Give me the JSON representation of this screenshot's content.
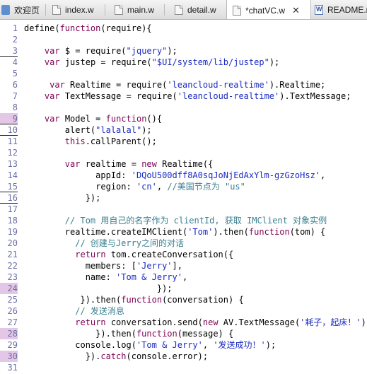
{
  "tabs": [
    {
      "label": "欢迎页",
      "icon": "welcome-page-icon",
      "active": false
    },
    {
      "label": "index.w",
      "icon": "w-file-icon",
      "active": false
    },
    {
      "label": "main.w",
      "icon": "w-file-icon",
      "active": false
    },
    {
      "label": "detail.w",
      "icon": "w-file-icon",
      "active": false
    },
    {
      "label": "*chatVC.w",
      "icon": "w-file-icon",
      "active": true
    },
    {
      "label": "README.m",
      "icon": "document-icon",
      "active": false
    }
  ],
  "close_glyph": "✕",
  "colors": {
    "keyword": "#7f0055",
    "string": "#1a2bc2",
    "comment": "#3b7f8f",
    "line_number": "#6b6fa7",
    "marker": "#e4c7e7"
  },
  "line_numbers": [
    "1",
    "2",
    "3",
    "4",
    "5",
    "6",
    "7",
    "8",
    "9",
    "10",
    "11",
    "12",
    "13",
    "14",
    "15",
    "16",
    "17",
    "18",
    "19",
    "20",
    "21",
    "22",
    "23",
    "24",
    "25",
    "26",
    "27",
    "28",
    "29",
    "30",
    "31"
  ],
  "highlighted_lines": [
    9,
    24,
    28,
    30
  ],
  "lines": [
    [
      [
        "t",
        "define("
      ],
      [
        "k",
        "function"
      ],
      [
        "t",
        "(require){"
      ]
    ],
    [],
    [
      [
        "t",
        "    "
      ],
      [
        "k",
        "var"
      ],
      [
        "t",
        " $ = require("
      ],
      [
        "s",
        "\"jquery\""
      ],
      [
        "t",
        ");"
      ]
    ],
    [
      [
        "t",
        "    "
      ],
      [
        "k",
        "var"
      ],
      [
        "t",
        " justep = require("
      ],
      [
        "s",
        "\"$UI/system/lib/justep\""
      ],
      [
        "t",
        ");"
      ]
    ],
    [],
    [
      [
        "t",
        "     "
      ],
      [
        "k",
        "var"
      ],
      [
        "t",
        " Realtime = require("
      ],
      [
        "s",
        "'leancloud-realtime'"
      ],
      [
        "t",
        ").Realtime;"
      ]
    ],
    [
      [
        "t",
        "    "
      ],
      [
        "k",
        "var"
      ],
      [
        "t",
        " TextMessage = require("
      ],
      [
        "s",
        "'leancloud-realtime'"
      ],
      [
        "t",
        ").TextMessage;"
      ]
    ],
    [],
    [
      [
        "t",
        "    "
      ],
      [
        "k",
        "var"
      ],
      [
        "t",
        " Model = "
      ],
      [
        "k",
        "function"
      ],
      [
        "t",
        "(){"
      ]
    ],
    [
      [
        "t",
        "        alert("
      ],
      [
        "s",
        "\"lalalal\""
      ],
      [
        "t",
        ");"
      ]
    ],
    [
      [
        "t",
        "        "
      ],
      [
        "k",
        "this"
      ],
      [
        "t",
        ".callParent();"
      ]
    ],
    [],
    [
      [
        "t",
        "        "
      ],
      [
        "k",
        "var"
      ],
      [
        "t",
        " realtime = "
      ],
      [
        "k",
        "new"
      ],
      [
        "t",
        " Realtime({"
      ]
    ],
    [
      [
        "t",
        "              appId: "
      ],
      [
        "s",
        "'DQoU500dff8A0sqJoNjEdAxYlm-gzGzoHsz'"
      ],
      [
        "t",
        ","
      ]
    ],
    [
      [
        "t",
        "              region: "
      ],
      [
        "s",
        "'cn'"
      ],
      [
        "t",
        ", "
      ],
      [
        "c",
        "//美国节点为 \"us\""
      ]
    ],
    [
      [
        "t",
        "            });"
      ]
    ],
    [],
    [
      [
        "t",
        "        "
      ],
      [
        "c",
        "// Tom 用自己的名字作为 clientId, 获取 IMClient 对象实例"
      ]
    ],
    [
      [
        "t",
        "        realtime.createIMClient("
      ],
      [
        "s",
        "'Tom'"
      ],
      [
        "t",
        ").then("
      ],
      [
        "k",
        "function"
      ],
      [
        "t",
        "(tom) {"
      ]
    ],
    [
      [
        "t",
        "          "
      ],
      [
        "c",
        "// 创建与Jerry之间的对话"
      ]
    ],
    [
      [
        "t",
        "          "
      ],
      [
        "k",
        "return"
      ],
      [
        "t",
        " tom.createConversation({"
      ]
    ],
    [
      [
        "t",
        "            members: ["
      ],
      [
        "s",
        "'Jerry'"
      ],
      [
        "t",
        "],"
      ]
    ],
    [
      [
        "t",
        "            name: "
      ],
      [
        "s",
        "'Tom & Jerry'"
      ],
      [
        "t",
        ","
      ]
    ],
    [
      [
        "t",
        "                          });"
      ]
    ],
    [
      [
        "t",
        "           }).then("
      ],
      [
        "k",
        "function"
      ],
      [
        "t",
        "(conversation) {"
      ]
    ],
    [
      [
        "t",
        "          "
      ],
      [
        "c",
        "// 发送消息"
      ]
    ],
    [
      [
        "t",
        "          "
      ],
      [
        "k",
        "return"
      ],
      [
        "t",
        " conversation.send("
      ],
      [
        "k",
        "new"
      ],
      [
        "t",
        " AV.TextMessage("
      ],
      [
        "s",
        "'耗子，起床！'"
      ],
      [
        "t",
        "));"
      ]
    ],
    [
      [
        "t",
        "              }).then("
      ],
      [
        "k",
        "function"
      ],
      [
        "t",
        "(message) {"
      ]
    ],
    [
      [
        "t",
        "          console.log("
      ],
      [
        "s",
        "'Tom & Jerry'"
      ],
      [
        "t",
        ", "
      ],
      [
        "s",
        "'发送成功！'"
      ],
      [
        "t",
        ");"
      ]
    ],
    [
      [
        "t",
        "            })."
      ],
      [
        "k",
        "catch"
      ],
      [
        "t",
        "(console.error);"
      ]
    ],
    []
  ]
}
